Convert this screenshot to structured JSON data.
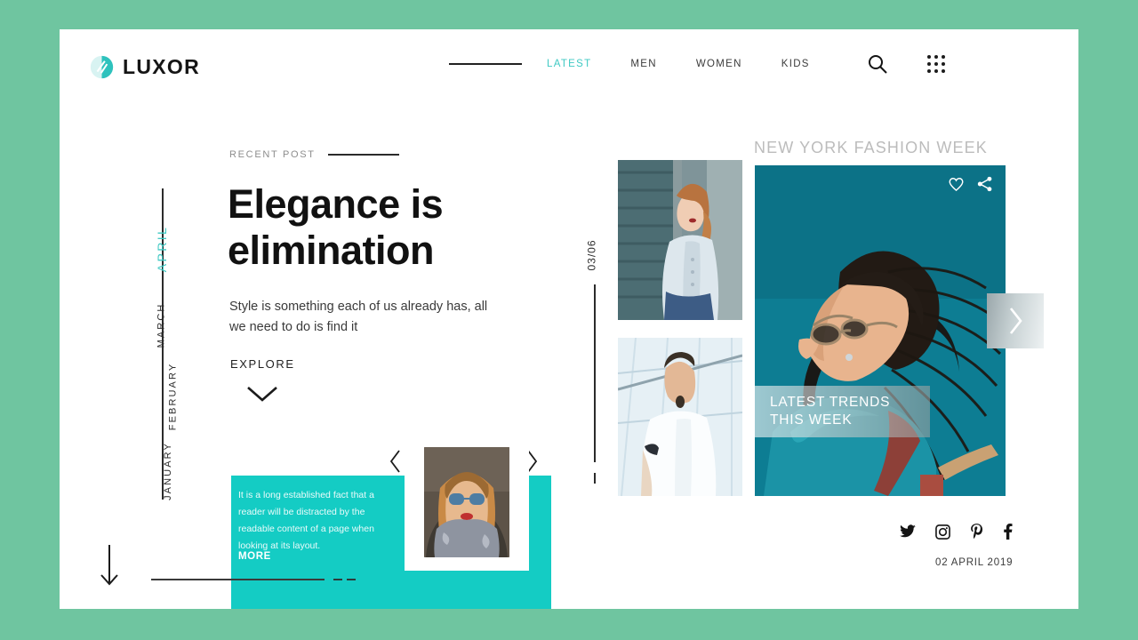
{
  "theme": {
    "page_bg": "#6fc5a0",
    "card_bg": "#ffffff",
    "accent_teal": "#3fc9c3",
    "promo_teal": "#14ccc4",
    "hero_teal": "#0d7086",
    "text_dark": "#111111",
    "text_muted": "#8d8d8d"
  },
  "header": {
    "logo_text": "LUXOR",
    "logo_icon": "leaf-circle-icon",
    "nav_items": [
      {
        "label": "LATEST",
        "active": true
      },
      {
        "label": "MEN",
        "active": false
      },
      {
        "label": "WOMEN",
        "active": false
      },
      {
        "label": "KIDS",
        "active": false
      }
    ],
    "search_icon": "search-icon",
    "menu_icon": "grid-menu-icon"
  },
  "months_rail": {
    "items": [
      {
        "label": "APRIL",
        "active": true
      },
      {
        "label": "MARCH",
        "active": false
      },
      {
        "label": "FEBRUARY",
        "active": false
      },
      {
        "label": "JANUARY",
        "active": false
      }
    ]
  },
  "hero_post": {
    "eyebrow": "RECENT POST",
    "headline_line1": "Elegance is",
    "headline_line2": "elimination",
    "subtitle": "Style is something each of us already has, all we need to do is find it",
    "explore_label": "EXPLORE",
    "explore_icon": "chevron-down-icon",
    "scroll_icon": "arrow-down-icon"
  },
  "promo": {
    "body": "It is a long established fact that a reader will be distracted by the readable content of a page when looking at its layout.",
    "more_label": "MORE",
    "prev_icon": "chevron-left-icon",
    "next_icon": "chevron-right-icon"
  },
  "counter": {
    "value": "03/06"
  },
  "feature": {
    "title": "NEW YORK FASHION WEEK",
    "caption_line1": "LATEST TRENDS",
    "caption_line2": "THIS WEEK",
    "like_icon": "heart-icon",
    "share_icon": "share-icon",
    "next_slide_icon": "chevron-right-icon"
  },
  "thumbnails": [
    {
      "alt_name": "thumbnail-woman-denim-jacket"
    },
    {
      "alt_name": "thumbnail-man-white-polo"
    }
  ],
  "footer": {
    "social": [
      {
        "name": "twitter-icon"
      },
      {
        "name": "instagram-icon"
      },
      {
        "name": "pinterest-icon"
      },
      {
        "name": "facebook-icon"
      }
    ],
    "date": "02 APRIL 2019"
  }
}
